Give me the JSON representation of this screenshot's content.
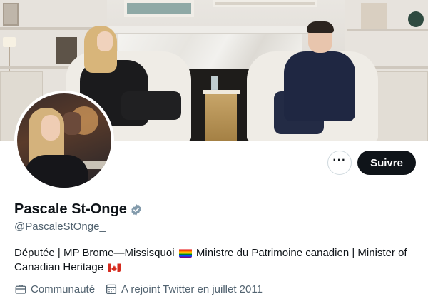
{
  "profile": {
    "display_name": "Pascale St-Onge",
    "handle": "@PascaleStOnge_",
    "verified_icon": "verified-badge-icon",
    "bio": {
      "part1": "Députée | MP Brome—Missisquoi",
      "part2": "Ministre du Patrimoine canadien | Minister of Canadian Heritage",
      "flag1_icon": "rainbow-flag-icon",
      "flag2_icon": "canada-flag-icon"
    },
    "category": "Communauté",
    "joined": "A rejoint Twitter en juillet 2011"
  },
  "actions": {
    "more_label": "···",
    "follow_label": "Suivre"
  },
  "colors": {
    "text_primary": "#0f1419",
    "text_secondary": "#536471",
    "verified": "#829aab",
    "follow_bg": "#0f1419",
    "border": "#cfd9de"
  }
}
